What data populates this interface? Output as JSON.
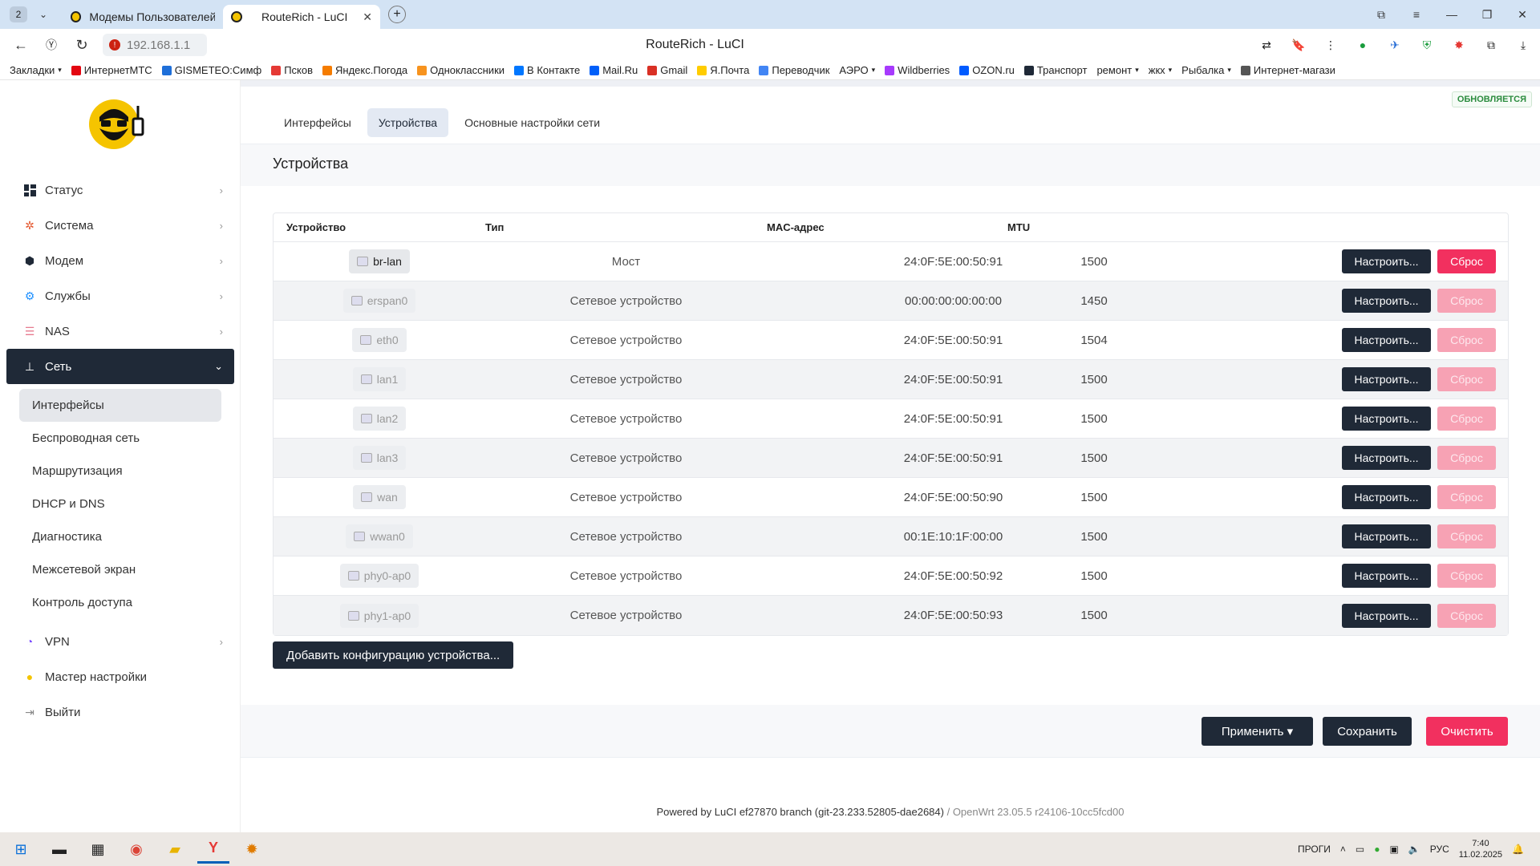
{
  "browser": {
    "tab_count": "2",
    "tabs": [
      {
        "title": "Модемы Пользователей ·",
        "active": false
      },
      {
        "title": "RouteRich - LuCI",
        "active": true
      }
    ],
    "url": "192.168.1.1",
    "page_title": "RouteRich - LuCI",
    "bookmarks": [
      {
        "label": "Закладки",
        "dropdown": true,
        "color": "#ffffff"
      },
      {
        "label": "ИнтернетМТС",
        "color": "#e30611"
      },
      {
        "label": "GISMETEO:Симф",
        "color": "#1e6fd9"
      },
      {
        "label": "Псков",
        "color": "#e53935"
      },
      {
        "label": "Яндекс.Погода",
        "color": "#f57c00"
      },
      {
        "label": "Одноклассники",
        "color": "#f7931e"
      },
      {
        "label": "В Контакте",
        "color": "#0077ff"
      },
      {
        "label": "Mail.Ru",
        "color": "#005ff9"
      },
      {
        "label": "Gmail",
        "color": "#d93025"
      },
      {
        "label": "Я.Почта",
        "color": "#ffcc00"
      },
      {
        "label": "Переводчик",
        "color": "#4285f4"
      },
      {
        "label": "АЭРО",
        "dropdown": true,
        "color": "#ffffff"
      },
      {
        "label": "Wildberries",
        "color": "#a73afd"
      },
      {
        "label": "OZON.ru",
        "color": "#005bff"
      },
      {
        "label": "Транспорт",
        "color": "#1f2937"
      },
      {
        "label": "ремонт",
        "dropdown": true,
        "color": "#ffffff"
      },
      {
        "label": "жкх",
        "dropdown": true,
        "color": "#ffffff"
      },
      {
        "label": "Рыбалка",
        "dropdown": true,
        "color": "#ffffff"
      },
      {
        "label": "Интернет-магази",
        "color": "#555555"
      }
    ]
  },
  "sidebar": {
    "menu": [
      {
        "label": "Статус",
        "icon": "dashboard-icon",
        "color": "#1f2937"
      },
      {
        "label": "Система",
        "icon": "gear-icon",
        "color": "#e4572e"
      },
      {
        "label": "Модем",
        "icon": "cube-icon",
        "color": "#1f2937"
      },
      {
        "label": "Службы",
        "icon": "services-icon",
        "color": "#1e90ff"
      },
      {
        "label": "NAS",
        "icon": "database-icon",
        "color": "#e77b8f"
      },
      {
        "label": "Сеть",
        "icon": "network-icon",
        "color": "#ffffff",
        "active": true
      }
    ],
    "submenu": [
      "Интерфейсы",
      "Беспроводная сеть",
      "Маршрутизация",
      "DHCP и DNS",
      "Диагностика",
      "Межсетевой экран",
      "Контроль доступа"
    ],
    "menu_after": [
      {
        "label": "VPN",
        "icon": "vpn-icon",
        "color": "#7c4dff"
      },
      {
        "label": "Мастер настройки",
        "icon": "wizard-icon",
        "color": "#f4c400"
      },
      {
        "label": "Выйти",
        "icon": "logout-icon",
        "color": "#888888"
      }
    ]
  },
  "main": {
    "status_badge": "ОБНОВЛЯЕТСЯ",
    "tabs": [
      {
        "label": "Интерфейсы"
      },
      {
        "label": "Устройства",
        "active": true
      },
      {
        "label": "Основные настройки сети"
      }
    ],
    "section_title": "Устройства",
    "table": {
      "headers": {
        "device": "Устройство",
        "type": "Тип",
        "mac": "MAC-адрес",
        "mtu": "MTU"
      },
      "rows": [
        {
          "device": "br-lan",
          "type": "Мост",
          "mac": "24:0F:5E:00:50:91",
          "mtu": "1500",
          "active": true
        },
        {
          "device": "erspan0",
          "type": "Сетевое устройство",
          "mac": "00:00:00:00:00:00",
          "mtu": "1450"
        },
        {
          "device": "eth0",
          "type": "Сетевое устройство",
          "mac": "24:0F:5E:00:50:91",
          "mtu": "1504"
        },
        {
          "device": "lan1",
          "type": "Сетевое устройство",
          "mac": "24:0F:5E:00:50:91",
          "mtu": "1500"
        },
        {
          "device": "lan2",
          "type": "Сетевое устройство",
          "mac": "24:0F:5E:00:50:91",
          "mtu": "1500"
        },
        {
          "device": "lan3",
          "type": "Сетевое устройство",
          "mac": "24:0F:5E:00:50:91",
          "mtu": "1500"
        },
        {
          "device": "wan",
          "type": "Сетевое устройство",
          "mac": "24:0F:5E:00:50:90",
          "mtu": "1500"
        },
        {
          "device": "wwan0",
          "type": "Сетевое устройство",
          "mac": "00:1E:10:1F:00:00",
          "mtu": "1500"
        },
        {
          "device": "phy0-ap0",
          "type": "Сетевое устройство",
          "mac": "24:0F:5E:00:50:92",
          "mtu": "1500"
        },
        {
          "device": "phy1-ap0",
          "type": "Сетевое устройство",
          "mac": "24:0F:5E:00:50:93",
          "mtu": "1500"
        }
      ],
      "configure_label": "Настроить...",
      "reset_label": "Сброс"
    },
    "add_device_label": "Добавить конфигурацию устройства...",
    "footer_buttons": {
      "apply": "Применить ▾",
      "save": "Сохранить",
      "reset": "Очистить"
    },
    "powered_by": "Powered by LuCI ef27870 branch (git-23.233.52805-dae2684)",
    "powered_sep": " / ",
    "powered_os": "OpenWrt 23.05.5 r24106-10cc5fcd00"
  },
  "taskbar": {
    "tray_label": "ПРОГИ",
    "lang": "РУС",
    "time": "7:40",
    "date": "11.02.2025"
  }
}
